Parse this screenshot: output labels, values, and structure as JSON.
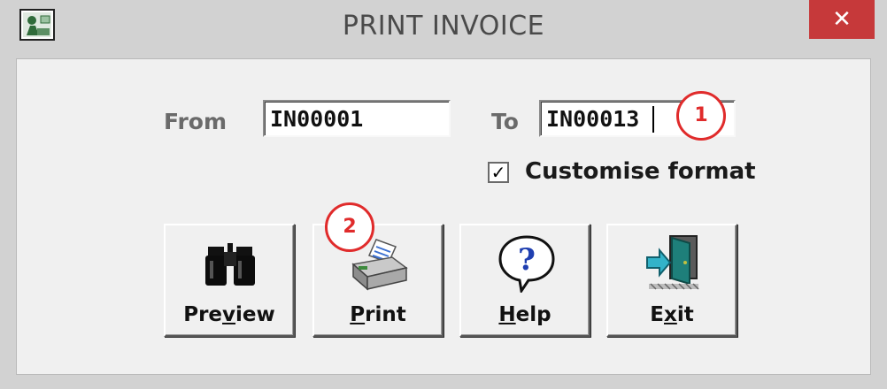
{
  "window": {
    "title": "PRINT INVOICE",
    "close_label": "✕"
  },
  "form": {
    "from_label": "From",
    "from_value": "IN00001",
    "to_label": "To",
    "to_value": "IN00013",
    "customise_checked": true,
    "customise_label": "Customise format",
    "check_mark": "✓"
  },
  "buttons": [
    {
      "label_pre": "Pre",
      "label_u": "v",
      "label_post": "iew",
      "icon": "binoculars-icon"
    },
    {
      "label_pre": "",
      "label_u": "P",
      "label_post": "rint",
      "icon": "printer-icon"
    },
    {
      "label_pre": "",
      "label_u": "H",
      "label_post": "elp",
      "icon": "help-bubble-icon"
    },
    {
      "label_pre": "E",
      "label_u": "x",
      "label_post": "it",
      "icon": "exit-door-icon"
    }
  ],
  "annotations": [
    {
      "number": "1"
    },
    {
      "number": "2"
    }
  ],
  "colors": {
    "close_red": "#c6393a",
    "marker_red": "#e02b2b"
  }
}
